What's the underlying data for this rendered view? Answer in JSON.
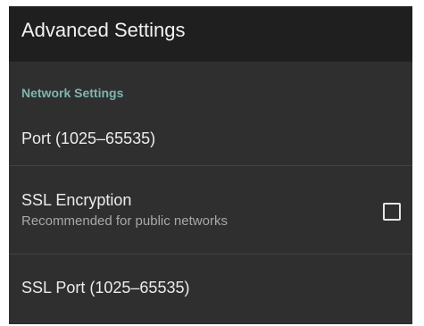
{
  "app_bar": {
    "title": "Advanced Settings"
  },
  "section": {
    "header": "Network Settings"
  },
  "preferences": {
    "port": {
      "title": "Port (1025–65535)"
    },
    "ssl_encryption": {
      "title": "SSL Encryption",
      "summary": "Recommended for public networks",
      "checked": false
    },
    "ssl_port": {
      "title": "SSL Port (1025–65535)"
    }
  },
  "colors": {
    "app_bar_background": "#1f1f1f",
    "screen_background": "#2f2f2f",
    "accent": "#7fb5b1",
    "primary_text": "#ececec",
    "secondary_text": "#a8a8a8",
    "divider": "#434343"
  },
  "icons": {
    "checkbox": "unchecked-checkbox-icon"
  }
}
